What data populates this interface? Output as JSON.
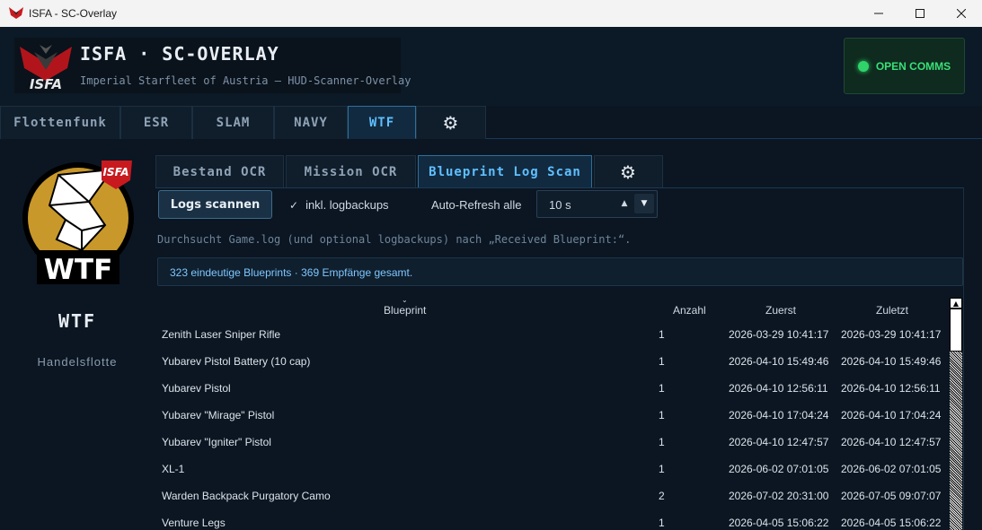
{
  "window": {
    "title": "ISFA - SC-Overlay",
    "minimize": "—",
    "maximize": "☐",
    "close": "✕"
  },
  "header": {
    "title": "ISFA · SC-OVERLAY",
    "subtitle": "Imperial Starfleet of Austria — HUD-Scanner-Overlay",
    "logo_text": "ISFA",
    "comms_label": "OPEN COMMS",
    "comms_color": "#2fd36a"
  },
  "top_tabs": [
    {
      "label": "Flottenfunk"
    },
    {
      "label": "ESR"
    },
    {
      "label": "SLAM"
    },
    {
      "label": "NAVY"
    },
    {
      "label": "WTF",
      "active": true
    },
    {
      "label": "⚙",
      "icon": "gear-icon"
    }
  ],
  "left_panel": {
    "logo_text": "WTF",
    "logo_badge": "ISFA",
    "name": "WTF",
    "subtitle": "Handelsflotte"
  },
  "sub_tabs": [
    {
      "label": "Bestand OCR"
    },
    {
      "label": "Mission OCR"
    },
    {
      "label": "Blueprint Log Scan",
      "active": true
    },
    {
      "label": "⚙",
      "icon": "gear-icon"
    }
  ],
  "toolbar": {
    "scan_label": "Logs scannen",
    "backup_label": "inkl. logbackups",
    "backup_checked": true,
    "autorefresh_label": "Auto-Refresh alle",
    "interval_value": "10 s"
  },
  "description": "Durchsucht Game.log (und optional logbackups) nach „Received Blueprint:“.",
  "summary": "323 eindeutige Blueprints · 369 Empfänge gesamt.",
  "table": {
    "columns": [
      "Blueprint",
      "Anzahl",
      "Zuerst",
      "Zuletzt"
    ],
    "rows": [
      {
        "blueprint": "Zenith Laser Sniper Rifle",
        "count": "1",
        "first": "2026-03-29 10:41:17",
        "last": "2026-03-29 10:41:17"
      },
      {
        "blueprint": "Yubarev Pistol Battery (10 cap)",
        "count": "1",
        "first": "2026-04-10 15:49:46",
        "last": "2026-04-10 15:49:46"
      },
      {
        "blueprint": "Yubarev Pistol",
        "count": "1",
        "first": "2026-04-10 12:56:11",
        "last": "2026-04-10 12:56:11"
      },
      {
        "blueprint": "Yubarev \"Mirage\" Pistol",
        "count": "1",
        "first": "2026-04-10 17:04:24",
        "last": "2026-04-10 17:04:24"
      },
      {
        "blueprint": "Yubarev \"Igniter\" Pistol",
        "count": "1",
        "first": "2026-04-10 12:47:57",
        "last": "2026-04-10 12:47:57"
      },
      {
        "blueprint": "XL-1",
        "count": "1",
        "first": "2026-06-02 07:01:05",
        "last": "2026-06-02 07:01:05"
      },
      {
        "blueprint": "Warden Backpack Purgatory Camo",
        "count": "2",
        "first": "2026-07-02 20:31:00",
        "last": "2026-07-05 09:07:07"
      },
      {
        "blueprint": "Venture Legs",
        "count": "1",
        "first": "2026-04-05 15:06:22",
        "last": "2026-04-05 15:06:22"
      }
    ]
  }
}
